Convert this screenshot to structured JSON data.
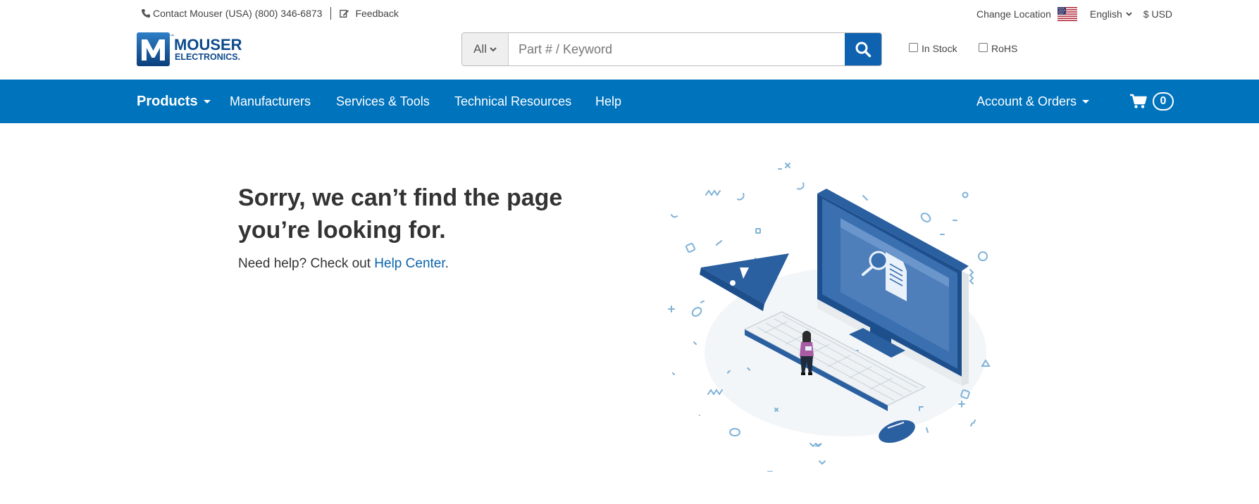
{
  "utility": {
    "contact_text": "Contact Mouser (USA) (800) 346-6873",
    "feedback_label": "Feedback",
    "change_location_label": "Change Location",
    "language": "English",
    "currency": "$ USD"
  },
  "logo": {
    "line1": "MOUSER",
    "line2": "ELECTRONICS.",
    "tm": "™"
  },
  "search": {
    "category": "All",
    "placeholder": "Part # / Keyword",
    "value": "",
    "in_stock_label": "In Stock",
    "rohs_label": "RoHS"
  },
  "nav": {
    "products": "Products",
    "manufacturers": "Manufacturers",
    "services_tools": "Services & Tools",
    "technical_resources": "Technical Resources",
    "help": "Help",
    "account_orders": "Account & Orders",
    "cart_count": "0"
  },
  "error": {
    "title_line1": "Sorry, we can’t find the page",
    "title_line2": "you’re looking for.",
    "help_prefix": "Need help? Check out ",
    "help_link": "Help Center",
    "help_suffix": "."
  },
  "colors": {
    "nav_blue": "#0073bd",
    "search_button": "#0e62b0",
    "link": "#0a64ad",
    "illustration_blue": "#2e63a3",
    "illustration_light": "#8ab8d9"
  },
  "icons": {
    "phone": "phone-icon",
    "feedback": "edit-icon",
    "flag": "us-flag-icon",
    "search": "search-icon",
    "cart": "shopping-cart-icon"
  }
}
